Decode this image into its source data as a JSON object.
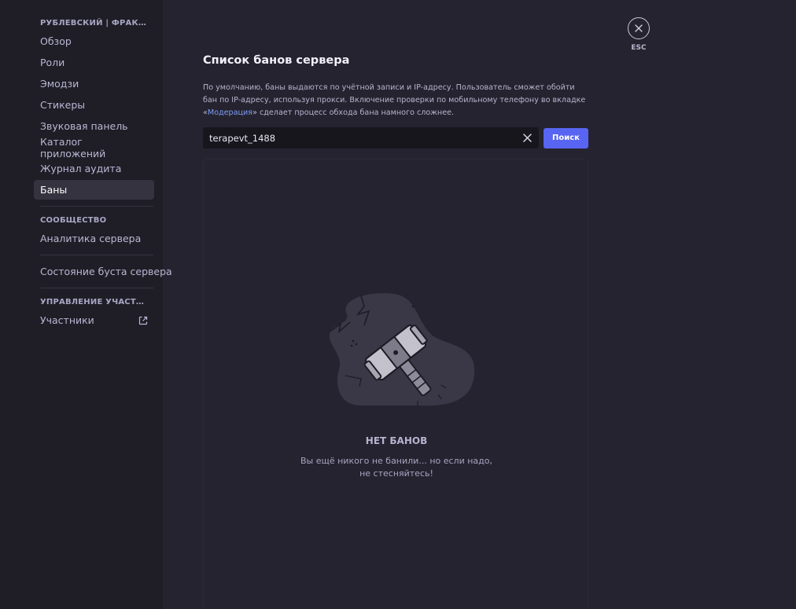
{
  "sidebar": {
    "server_header": "РУБЛЕВСКИЙ | ФРАКЦИИ",
    "items": [
      {
        "label": "Обзор"
      },
      {
        "label": "Роли"
      },
      {
        "label": "Эмодзи"
      },
      {
        "label": "Стикеры"
      },
      {
        "label": "Звуковая панель"
      },
      {
        "label": "Каталог приложений"
      },
      {
        "label": "Журнал аудита"
      },
      {
        "label": "Баны",
        "active": true
      }
    ],
    "community_header": "СООБЩЕСТВО",
    "community_items": [
      {
        "label": "Аналитика сервера"
      }
    ],
    "boost_item": "Состояние буста сервера",
    "members_header": "УПРАВЛЕНИЕ УЧАСТНИКА...",
    "members_items": [
      {
        "label": "Участники",
        "icon": "external-link-icon"
      }
    ]
  },
  "main": {
    "title": "Список банов сервера",
    "description_part1": "По умолчанию, баны выдаются по учётной записи и IP-адресу. Пользователь сможет обойти бан по IP-адресу, используя прокси. Включение проверки по мобильному телефону во вкладке «",
    "description_link": "Модерация",
    "description_part2": "» сделает процесс обхода бана намного сложнее.",
    "search": {
      "value": "terapevt_1488",
      "button_label": "Поиск"
    },
    "empty": {
      "title": "НЕТ БАНОВ",
      "subtitle": "Вы ещё никого не банили... но если надо, не стесняйтесь!"
    }
  },
  "close": {
    "label": "ESC"
  },
  "colors": {
    "accent": "#5865f2",
    "link": "#7c9cf4",
    "sidebar_bg": "#1f1e26",
    "main_bg": "#25232f"
  }
}
